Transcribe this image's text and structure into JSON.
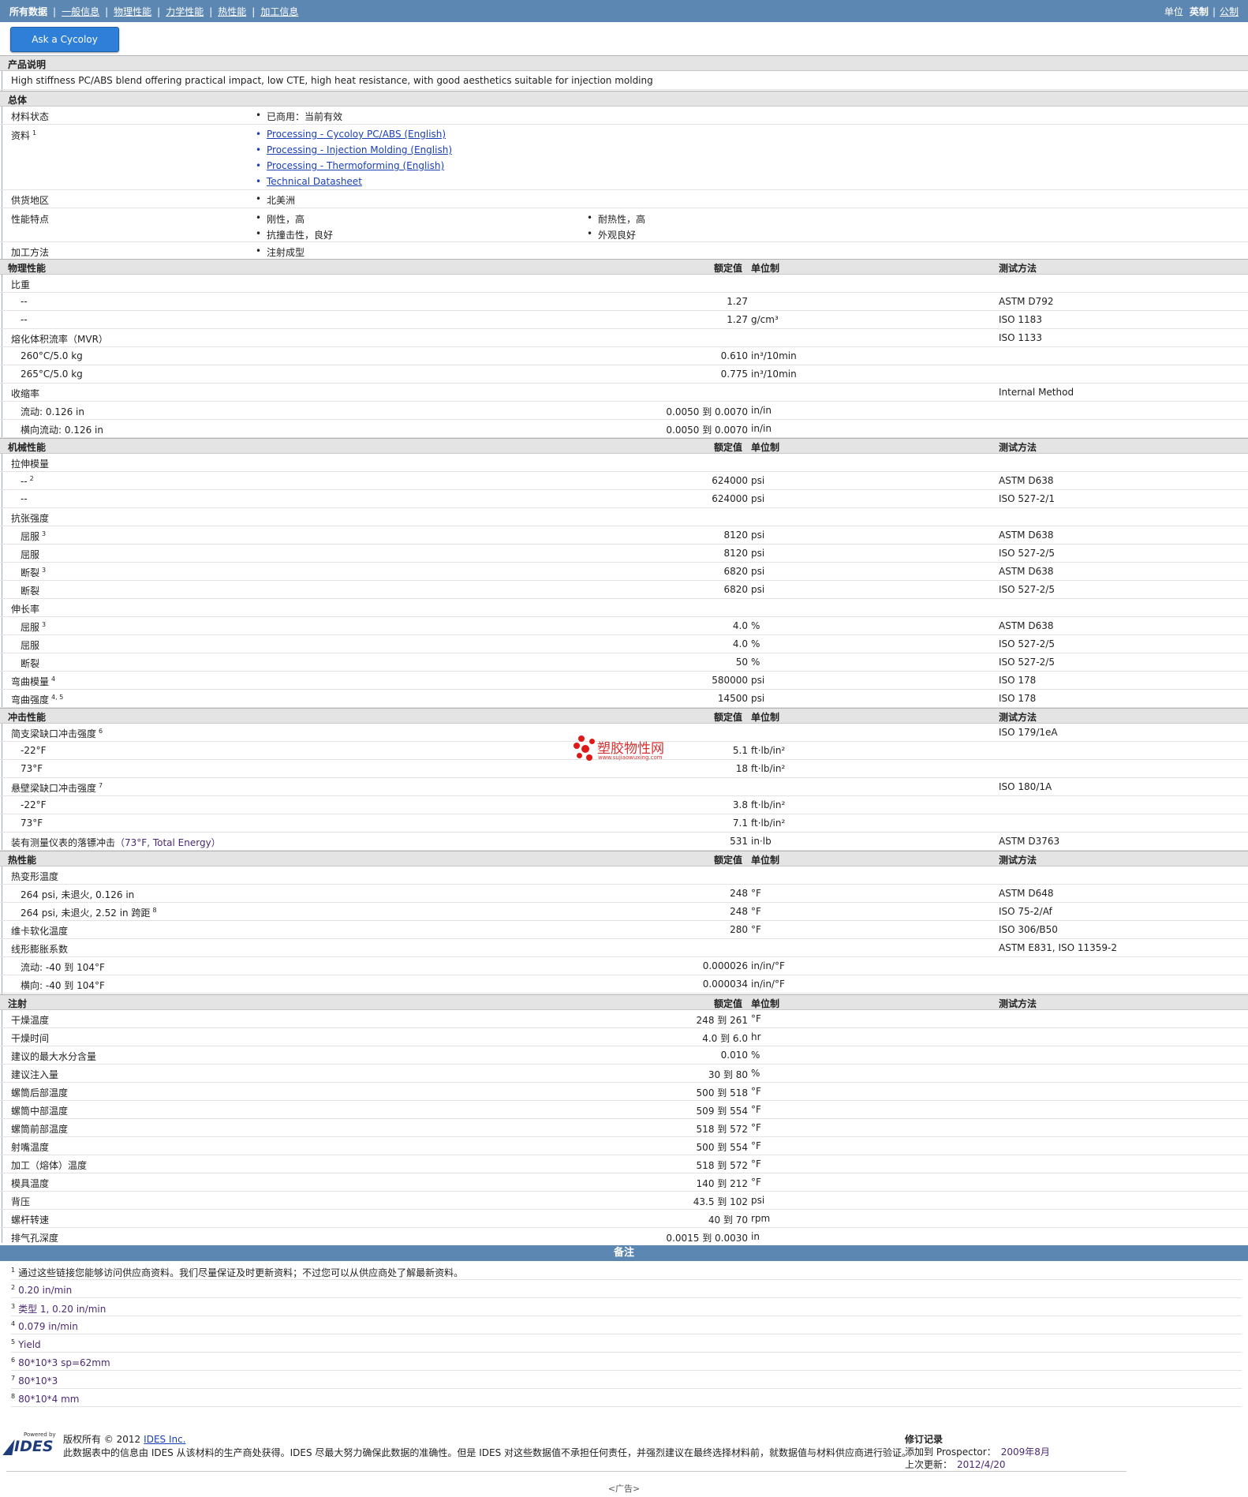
{
  "nav": {
    "tabs": [
      "所有数据",
      "一般信息",
      "物理性能",
      "力学性能",
      "热性能",
      "加工信息"
    ],
    "units_label": "单位",
    "unit_english": "英制",
    "unit_metric": "公制"
  },
  "engineer_button": "Ask a Cycoloy Engineer",
  "description": {
    "title": "产品说明",
    "text": "High stiffness PC/ABS blend offering practical impact, low CTE, high heat resistance, with good aesthetics suitable for injection molding"
  },
  "general": {
    "title": "总体",
    "status_label": "材料状态",
    "status_value": "已商用：当前有效",
    "docs_label": "资料",
    "docs_note": "1",
    "docs": [
      "Processing - Cycoloy PC/ABS (English)",
      "Processing - Injection Molding (English)",
      "Processing - Thermoforming (English)",
      "Technical Datasheet"
    ],
    "region_label": "供货地区",
    "region_value": "北美洲",
    "features_label": "性能特点",
    "features": [
      "刚性，高",
      "耐热性，高",
      "抗撞击性，良好",
      "外观良好"
    ],
    "process_label": "加工方法",
    "process_value": "注射成型"
  },
  "col_headers": {
    "nominal": "额定值",
    "unit": "单位制",
    "method": "测试方法"
  },
  "physical": {
    "title": "物理性能",
    "sg_label": "比重",
    "sg_rows": [
      {
        "label": "--",
        "value": "1.27",
        "unit": "",
        "method": "ASTM D792"
      },
      {
        "label": "--",
        "value": "1.27",
        "unit": "g/cm³",
        "method": "ISO 1183"
      }
    ],
    "mvr_label": "熔化体积流率（MVR）",
    "mvr_method": "ISO 1133",
    "mvr_rows": [
      {
        "label": "260°C/5.0 kg",
        "value": "0.610",
        "unit": "in³/10min"
      },
      {
        "label": "265°C/5.0 kg",
        "value": "0.775",
        "unit": "in³/10min"
      }
    ],
    "shrink_label": "收缩率",
    "shrink_method": "Internal Method",
    "shrink_rows": [
      {
        "label": "流动: 0.126 in",
        "value": "0.0050 到  0.0070",
        "unit": "in/in"
      },
      {
        "label": "横向流动: 0.126 in",
        "value": "0.0050 到  0.0070",
        "unit": "in/in"
      }
    ]
  },
  "mechanical": {
    "title": "机械性能",
    "tm_label": "拉伸模量",
    "tm_rows": [
      {
        "label": "--",
        "note": "2",
        "value": "624000",
        "unit": "psi",
        "method": "ASTM D638"
      },
      {
        "label": "--",
        "note": "",
        "value": "624000",
        "unit": "psi",
        "method": "ISO 527-2/1"
      }
    ],
    "ts_label": "抗张强度",
    "ts_rows": [
      {
        "label": "屈服",
        "note": "3",
        "value": "8120",
        "unit": "psi",
        "method": "ASTM D638"
      },
      {
        "label": "屈服",
        "note": "",
        "value": "8120",
        "unit": "psi",
        "method": "ISO 527-2/5"
      },
      {
        "label": "断裂",
        "note": "3",
        "value": "6820",
        "unit": "psi",
        "method": "ASTM D638"
      },
      {
        "label": "断裂",
        "note": "",
        "value": "6820",
        "unit": "psi",
        "method": "ISO 527-2/5"
      }
    ],
    "el_label": "伸长率",
    "el_rows": [
      {
        "label": "屈服",
        "note": "3",
        "value": "4.0",
        "unit": "%",
        "method": "ASTM D638"
      },
      {
        "label": "屈服",
        "note": "",
        "value": "4.0",
        "unit": "%",
        "method": "ISO 527-2/5"
      },
      {
        "label": "断裂",
        "note": "",
        "value": "50",
        "unit": "%",
        "method": "ISO 527-2/5"
      }
    ],
    "fm": {
      "label": "弯曲模量",
      "note": "4",
      "value": "580000",
      "unit": "psi",
      "method": "ISO 178"
    },
    "fs": {
      "label": "弯曲强度",
      "note": "4, 5",
      "value": "14500",
      "unit": "psi",
      "method": "ISO 178"
    }
  },
  "impact": {
    "title": "冲击性能",
    "charpy_label": "简支梁缺口冲击强度",
    "charpy_note": "6",
    "charpy_method": "ISO 179/1eA",
    "charpy_rows": [
      {
        "label": "-22°F",
        "value": "5.1",
        "unit": "ft·lb/in²"
      },
      {
        "label": "73°F",
        "value": "18",
        "unit": "ft·lb/in²"
      }
    ],
    "izod_label": "悬壁梁缺口冲击强度",
    "izod_note": "7",
    "izod_method": "ISO 180/1A",
    "izod_rows": [
      {
        "label": "-22°F",
        "value": "3.8",
        "unit": "ft·lb/in²"
      },
      {
        "label": "73°F",
        "value": "7.1",
        "unit": "ft·lb/in²"
      }
    ],
    "dart": {
      "label": "装有测量仪表的落镖冲击",
      "extra": "（73°F, Total Energy）",
      "value": "531",
      "unit": "in·lb",
      "method": "ASTM D3763"
    }
  },
  "thermal": {
    "title": "热性能",
    "hdt_label": "热变形温度",
    "hdt_rows": [
      {
        "label": "264 psi, 未退火, 0.126 in",
        "note": "",
        "value": "248",
        "unit": "°F",
        "method": "ASTM D648"
      },
      {
        "label": "264 psi, 未退火, 2.52 in 跨距",
        "note": "8",
        "value": "248",
        "unit": "°F",
        "method": "ISO 75-2/Af"
      }
    ],
    "vicat": {
      "label": "维卡软化温度",
      "value": "280",
      "unit": "°F",
      "method": "ISO 306/B50"
    },
    "clte_label": "线形膨胀系数",
    "clte_method": "ASTM E831, ISO 11359-2",
    "clte_rows": [
      {
        "label": "流动: -40 到  104°F",
        "value": "0.000026",
        "unit": "in/in/°F"
      },
      {
        "label": "横向: -40 到  104°F",
        "value": "0.000034",
        "unit": "in/in/°F"
      }
    ]
  },
  "injection": {
    "title": "注射",
    "rows": [
      {
        "label": "干燥温度",
        "value": "248 到  261",
        "unit": "°F"
      },
      {
        "label": "干燥时间",
        "value": "4.0 到  6.0",
        "unit": "hr"
      },
      {
        "label": "建议的最大水分含量",
        "value": "0.010",
        "unit": "%"
      },
      {
        "label": "建议注入量",
        "value": "30 到  80",
        "unit": "%"
      },
      {
        "label": "螺筒后部温度",
        "value": "500 到  518",
        "unit": "°F"
      },
      {
        "label": "螺筒中部温度",
        "value": "509 到  554",
        "unit": "°F"
      },
      {
        "label": "螺筒前部温度",
        "value": "518 到  572",
        "unit": "°F"
      },
      {
        "label": "射嘴温度",
        "value": "500 到  554",
        "unit": "°F"
      },
      {
        "label": "加工（熔体）温度",
        "value": "518 到  572",
        "unit": "°F"
      },
      {
        "label": "模具温度",
        "value": "140 到  212",
        "unit": "°F"
      },
      {
        "label": "背压",
        "value": "43.5 到  102",
        "unit": "psi"
      },
      {
        "label": "螺杆转速",
        "value": "40 到  70",
        "unit": "rpm"
      },
      {
        "label": "排气孔深度",
        "value": "0.0015 到  0.0030",
        "unit": "in"
      }
    ]
  },
  "notes": {
    "title": "备注",
    "items": [
      {
        "n": "1",
        "text": "通过这些链接您能够访问供应商资料。我们尽量保证及时更新资料；不过您可以从供应商处了解最新资料。"
      },
      {
        "n": "2",
        "text": "0.20 in/min"
      },
      {
        "n": "3",
        "text": "类型  1, 0.20 in/min"
      },
      {
        "n": "4",
        "text": "0.079 in/min"
      },
      {
        "n": "5",
        "text": "Yield"
      },
      {
        "n": "6",
        "text": "80*10*3 sp=62mm"
      },
      {
        "n": "7",
        "text": "80*10*3"
      },
      {
        "n": "8",
        "text": "80*10*4 mm"
      }
    ]
  },
  "footer": {
    "powered_by": "Powered by",
    "logo_text": "IDES",
    "copyright": "版权所有  © 2012",
    "company_link": "IDES Inc.",
    "disclaimer": "此数据表中的信息由  IDES 从该材料的生产商处获得。IDES 尽最大努力确保此数据的准确性。但是  IDES 对这些数据值不承担任何责任，并强烈建议在最终选择材料前，就数据值与材料供应商进行验证。",
    "rev_title": "修订记录",
    "added_label": "添加到  Prospector：",
    "added_value": "2009年8月",
    "updated_label": "上次更新：",
    "updated_value": "2012/4/20",
    "ad": "<广告>"
  },
  "watermark": {
    "cn": "塑胶物性网",
    "en": "www.sujiaowuxing.com"
  }
}
